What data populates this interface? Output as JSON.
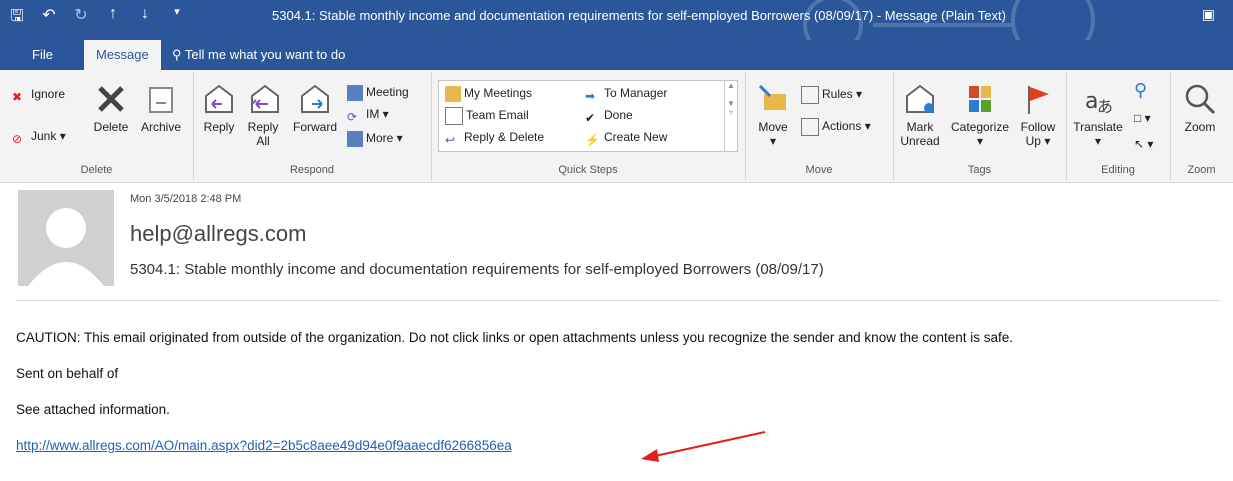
{
  "window": {
    "title": "5304.1: Stable monthly income and documentation requirements for self-employed Borrowers (08/09/17)  -  Message (Plain Text)"
  },
  "tabs": {
    "file": "File",
    "message": "Message",
    "tell_me": "Tell me what you want to do"
  },
  "ribbon": {
    "delete": {
      "ignore": "Ignore",
      "junk": "Junk",
      "delete": "Delete",
      "archive": "Archive",
      "label": "Delete"
    },
    "respond": {
      "reply": "Reply",
      "reply_all_1": "Reply",
      "reply_all_2": "All",
      "forward": "Forward",
      "meeting": "Meeting",
      "im": "IM",
      "more": "More",
      "label": "Respond"
    },
    "quick_steps": {
      "my_meetings": "My Meetings",
      "team_email": "Team Email",
      "reply_delete": "Reply & Delete",
      "to_manager": "To Manager",
      "done": "Done",
      "create_new": "Create New",
      "label": "Quick Steps"
    },
    "move": {
      "move": "Move",
      "rules": "Rules",
      "actions": "Actions",
      "label": "Move"
    },
    "tags": {
      "mark_unread_1": "Mark",
      "mark_unread_2": "Unread",
      "categorize": "Categorize",
      "follow_up_1": "Follow",
      "follow_up_2": "Up",
      "label": "Tags"
    },
    "editing": {
      "translate": "Translate",
      "label": "Editing"
    },
    "zoom": {
      "zoom": "Zoom",
      "label": "Zoom"
    }
  },
  "message": {
    "date": "Mon 3/5/2018 2:48 PM",
    "from": "help@allregs.com",
    "subject": "5304.1: Stable monthly income and documentation requirements for self-employed Borrowers (08/09/17)",
    "caution": "CAUTION: This email originated from outside of the organization. Do not click links or open attachments unless you recognize the sender and know the content is safe.",
    "sent_on_behalf": "Sent on behalf of",
    "see_attached": "See attached information.",
    "link": "http://www.allregs.com/AO/main.aspx?did2=2b5c8aee49d94e0f9aaecdf6266856ea"
  },
  "colors": {
    "brand": "#2b579a",
    "link": "#1f5fb8",
    "arrow": "#e0201b"
  }
}
